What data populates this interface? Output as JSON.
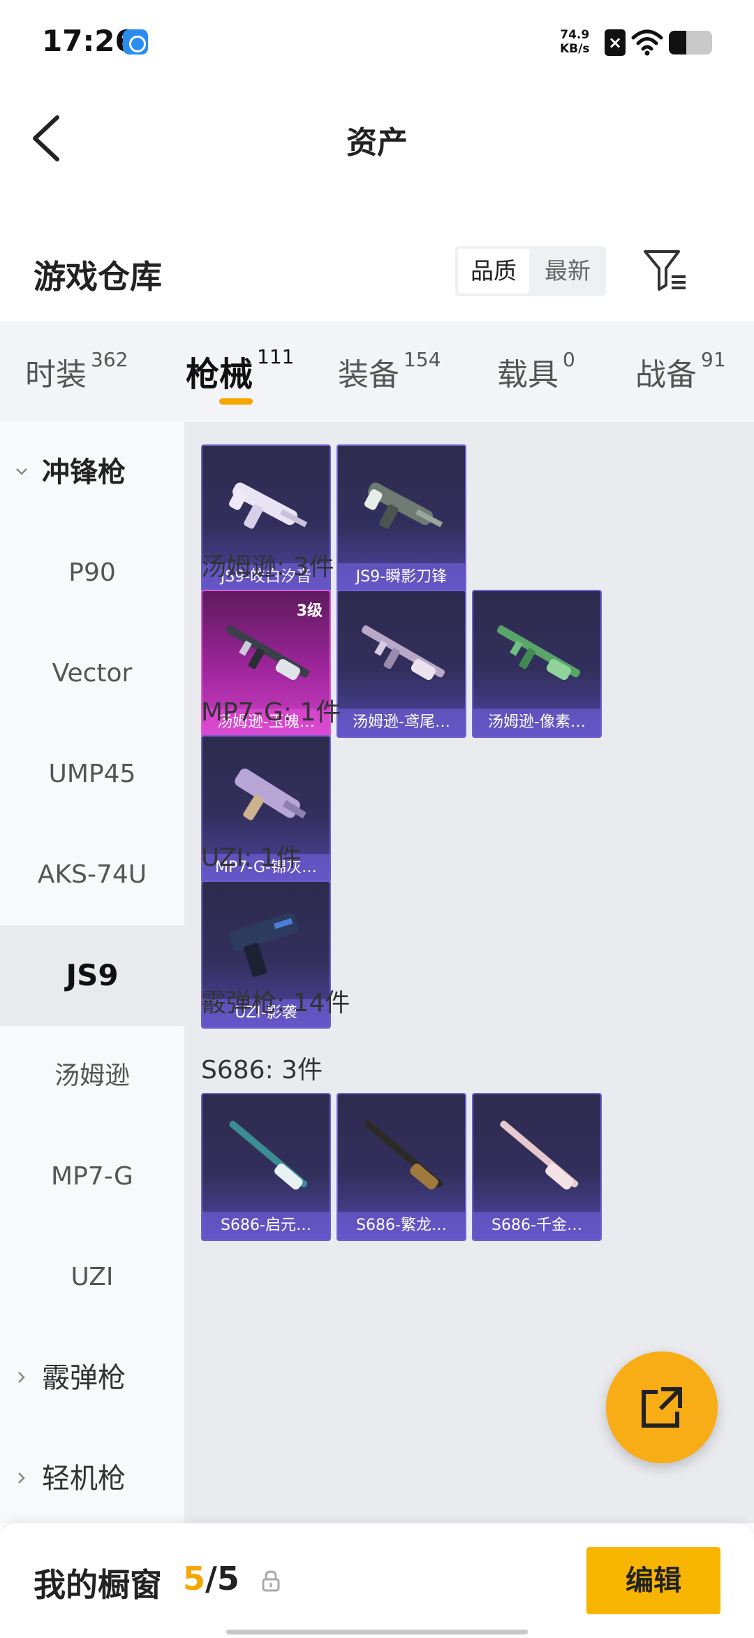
{
  "status_bar": {
    "time": "17:26",
    "net_speed_value": "74.9",
    "net_speed_unit": "KB/s",
    "battery_level": 0.4
  },
  "header": {
    "title": "资产"
  },
  "warehouse": {
    "title": "游戏仓库",
    "sort_options": [
      "品质",
      "最新"
    ],
    "active_sort": "品质"
  },
  "tabs": [
    {
      "label": "时装",
      "count": "362"
    },
    {
      "label": "枪械",
      "count": "111",
      "active": true
    },
    {
      "label": "装备",
      "count": "154"
    },
    {
      "label": "载具",
      "count": "0"
    },
    {
      "label": "战备",
      "count": "91"
    }
  ],
  "sidebar": {
    "items": [
      {
        "label": "冲锋枪",
        "type": "group",
        "expanded": true
      },
      {
        "label": "P90"
      },
      {
        "label": "Vector"
      },
      {
        "label": "UMP45"
      },
      {
        "label": "AKS-74U"
      },
      {
        "label": "JS9",
        "selected": true
      },
      {
        "label": "汤姆逊"
      },
      {
        "label": "MP7-G"
      },
      {
        "label": "UZI"
      },
      {
        "label": "霰弹枪",
        "type": "group",
        "expanded": false
      },
      {
        "label": "轻机枪",
        "type": "group",
        "expanded": false
      }
    ]
  },
  "content": {
    "sections": [
      {
        "label": "",
        "items": [
          {
            "name": "JS9-皎白汐音",
            "rarity": "blue"
          },
          {
            "name": "JS9-瞬影刀锋",
            "rarity": "blue"
          }
        ]
      },
      {
        "label": "汤姆逊: 3件",
        "items": [
          {
            "name": "汤姆逊-玉魄…",
            "rarity": "purple",
            "level": "3级"
          },
          {
            "name": "汤姆逊-鸢尾…",
            "rarity": "blue"
          },
          {
            "name": "汤姆逊-像素…",
            "rarity": "blue"
          }
        ]
      },
      {
        "label": "MP7-G: 1件",
        "items": [
          {
            "name": "MP7-G-锦灰…",
            "rarity": "blue"
          }
        ]
      },
      {
        "label": "UZI: 1件",
        "items": [
          {
            "name": "UZI-影袭",
            "rarity": "blue"
          }
        ]
      },
      {
        "label": "霰弹枪: 14件",
        "items": []
      },
      {
        "label": "S686: 3件",
        "items": [
          {
            "name": "S686-启元…",
            "rarity": "blue"
          },
          {
            "name": "S686-繁龙…",
            "rarity": "blue"
          },
          {
            "name": "S686-千金…",
            "rarity": "blue"
          }
        ]
      }
    ]
  },
  "bottom_bar": {
    "showcase_label": "我的橱窗",
    "showcase_current": "5",
    "showcase_total": "/5",
    "edit_label": "编辑"
  },
  "colors": {
    "accent": "#f7a600",
    "card_blue": "#332f5d",
    "card_purple": "#a0269e"
  }
}
